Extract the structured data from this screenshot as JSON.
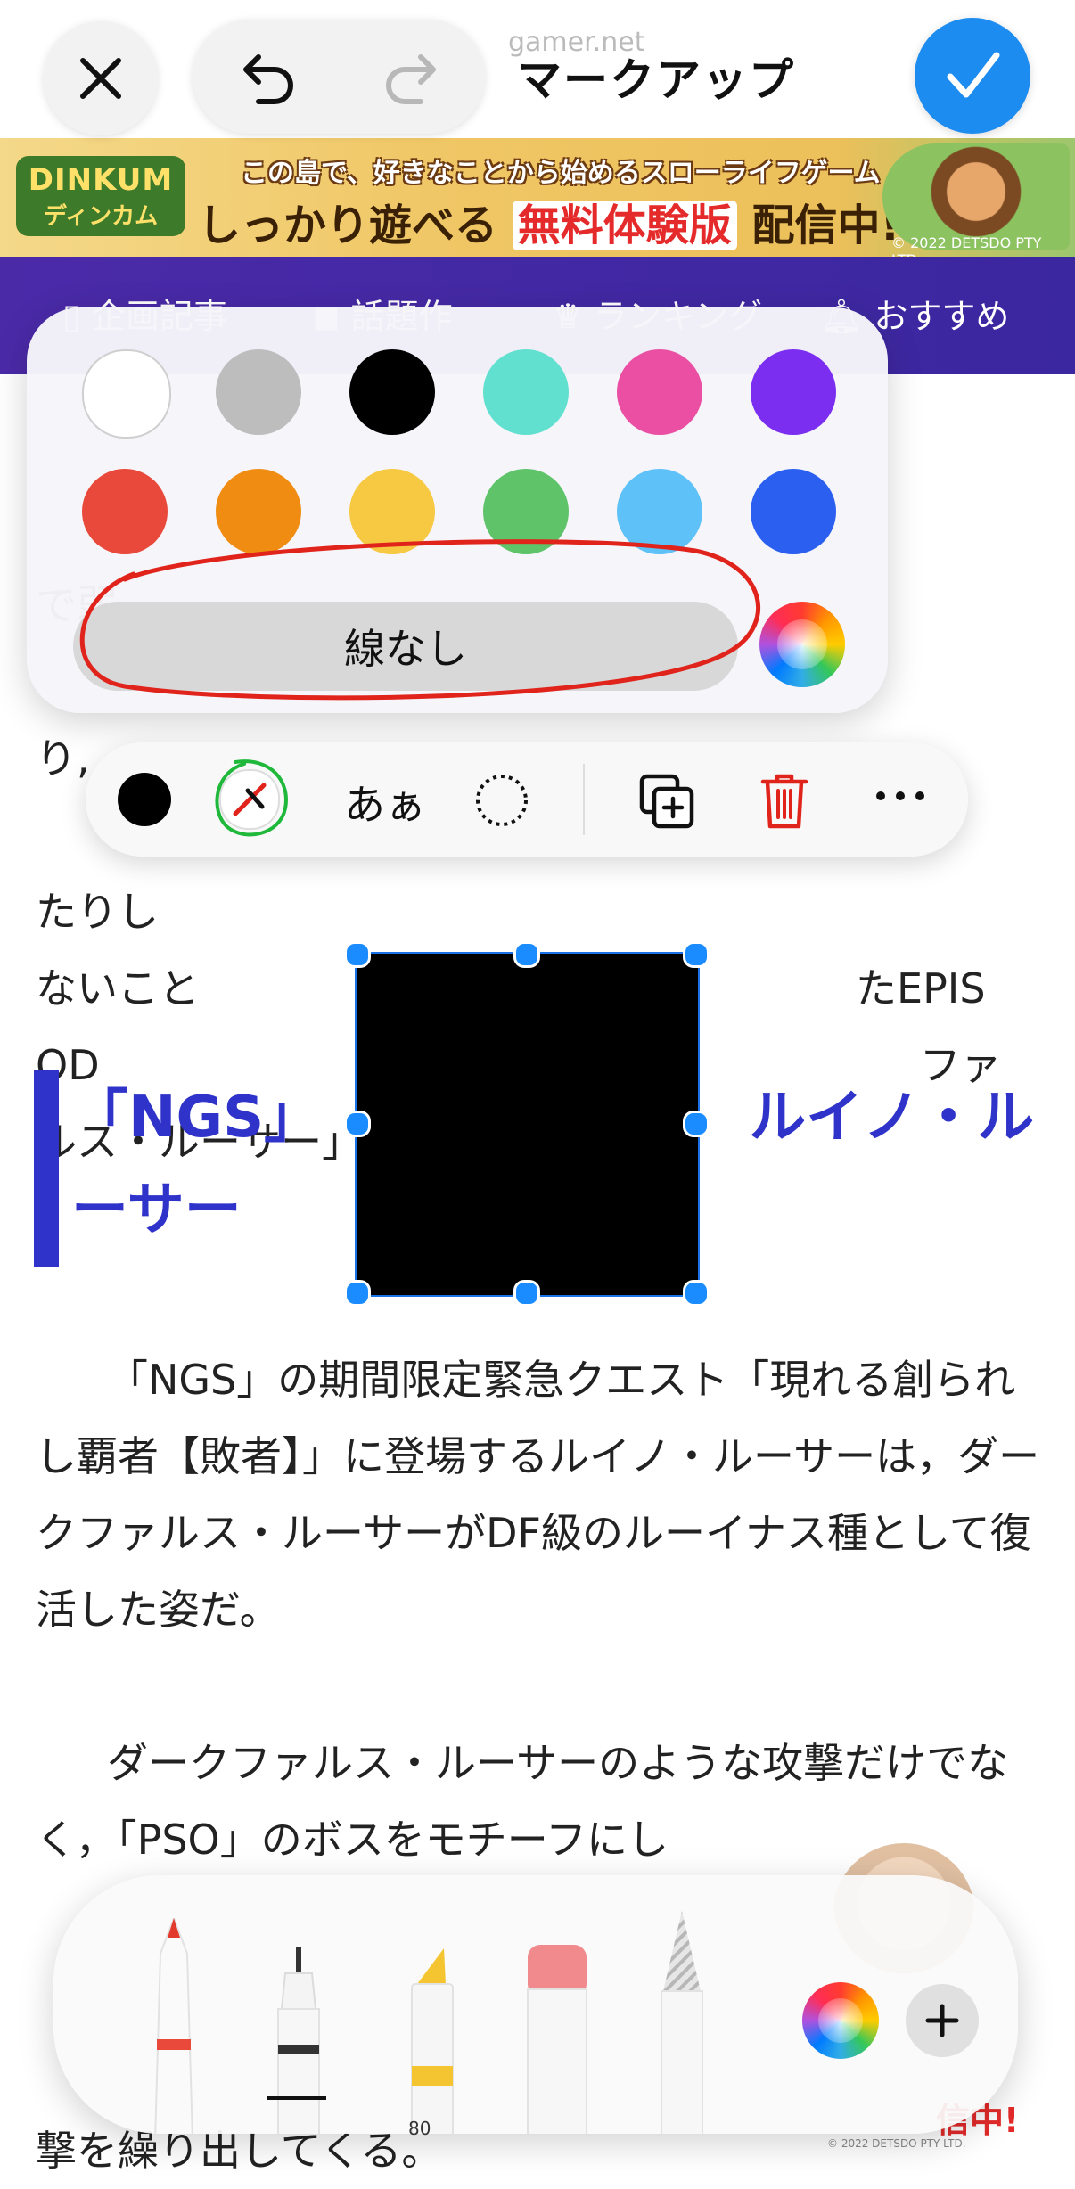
{
  "header": {
    "title": "マークアップ",
    "ghost_title": "gamer.net"
  },
  "banner": {
    "logo_en": "DINKUM",
    "logo_jp": "ディンカム",
    "tagline": "この島で、好きなことから始めるスローライフゲーム",
    "main_before": "しっかり遊べる",
    "main_highlight": "無料体験版",
    "main_after": "配信中!",
    "copyright": "© 2022 DETSDO PTY LTD."
  },
  "nav": {
    "items": [
      "企画記事",
      "話題作",
      "ランキング",
      "おすすめ"
    ]
  },
  "palette": {
    "colors": [
      "#ffffff",
      "#bdbdbd",
      "#000000",
      "#62e0cf",
      "#ea4fa3",
      "#7b2ef0",
      "#e8493a",
      "#f08c12",
      "#f7c942",
      "#5fc36a",
      "#5ec1f7",
      "#2a5ff0"
    ],
    "no_stroke_label": "線なし"
  },
  "shape_toolbar": {
    "font_label": "あぁ",
    "fill_color": "#000000"
  },
  "article": {
    "para0_lines": [
      "　　　　　　　　　　　　　　　　　　　　　　　　で弱",
      "　　　　　　　　　　　　　　　　　　　　　　　　り,",
      "　　　　　　　　　　　　　　　　　　　　　　　　たりし",
      "ないこと　　　　　　　　　　　　　　　　たEPIS",
      "OD　　　　　　　　　　　　　　　　　　　　ファ",
      "ルス・ルーサー」が登場する。"
    ],
    "heading_line1": "「NGS」　　　　　　　　ルイノ・ル",
    "heading_line2": "ーサー",
    "para1": "「NGS」の期間限定緊急クエスト「現れる創られし覇者【敗者】」に登場するルイノ・ルーサーは，ダークファルス・ルーサーがDF級のルーイナス種として復活した姿だ。",
    "para2": "ダークファルス・ルーサーのような攻撃だけでなく，「PSO」のボスをモチーフにし",
    "bottom_line": "撃を繰り出してくる。",
    "promo": "信中!",
    "promo_copy": "© 2022 DETSDO PTY LTD."
  },
  "tools": {
    "marker_width": "80"
  }
}
